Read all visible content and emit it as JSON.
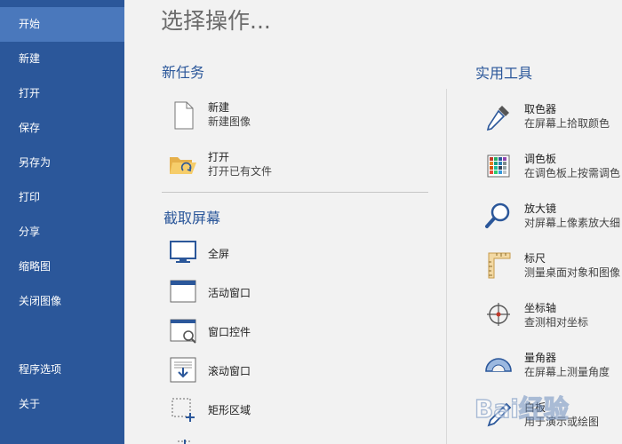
{
  "sidebar": {
    "items": [
      {
        "label": "开始"
      },
      {
        "label": "新建"
      },
      {
        "label": "打开"
      },
      {
        "label": "保存"
      },
      {
        "label": "另存为"
      },
      {
        "label": "打印"
      },
      {
        "label": "分享"
      },
      {
        "label": "缩略图"
      },
      {
        "label": "关闭图像"
      },
      {
        "label": "程序选项"
      },
      {
        "label": "关于"
      }
    ],
    "active_index": 0
  },
  "main": {
    "title": "选择操作...",
    "new_task": {
      "title": "新任务",
      "items": [
        {
          "label": "新建",
          "desc": "新建图像",
          "icon": "blank-document-icon"
        },
        {
          "label": "打开",
          "desc": "打开已有文件",
          "icon": "open-folder-icon"
        }
      ]
    },
    "capture": {
      "title": "截取屏幕",
      "items": [
        {
          "label": "全屏",
          "icon": "monitor-icon"
        },
        {
          "label": "活动窗口",
          "icon": "window-icon"
        },
        {
          "label": "窗口控件",
          "icon": "window-control-icon"
        },
        {
          "label": "滚动窗口",
          "icon": "scroll-window-icon"
        },
        {
          "label": "矩形区域",
          "icon": "rectangle-region-icon"
        }
      ]
    },
    "tools": {
      "title": "实用工具",
      "items": [
        {
          "label": "取色器",
          "desc": "在屏幕上拾取颜色",
          "icon": "eyedropper-icon"
        },
        {
          "label": "调色板",
          "desc": "在调色板上按需调色",
          "icon": "palette-grid-icon"
        },
        {
          "label": "放大镜",
          "desc": "对屏幕上像素放大细",
          "icon": "magnifier-icon"
        },
        {
          "label": "标尺",
          "desc": "测量桌面对象和图像",
          "icon": "ruler-icon"
        },
        {
          "label": "坐标轴",
          "desc": "查测相对坐标",
          "icon": "crosshair-icon"
        },
        {
          "label": "量角器",
          "desc": "在屏幕上测量角度",
          "icon": "protractor-icon"
        },
        {
          "label": "白板",
          "desc": "用于演示或绘图",
          "icon": "pen-icon"
        }
      ]
    }
  },
  "watermark": {
    "text": "Bai经验"
  },
  "colors": {
    "sidebar": "#2b579a",
    "sidebar_active": "#4a78bc",
    "accent": "#2b579a",
    "background": "#f2f2f2"
  }
}
